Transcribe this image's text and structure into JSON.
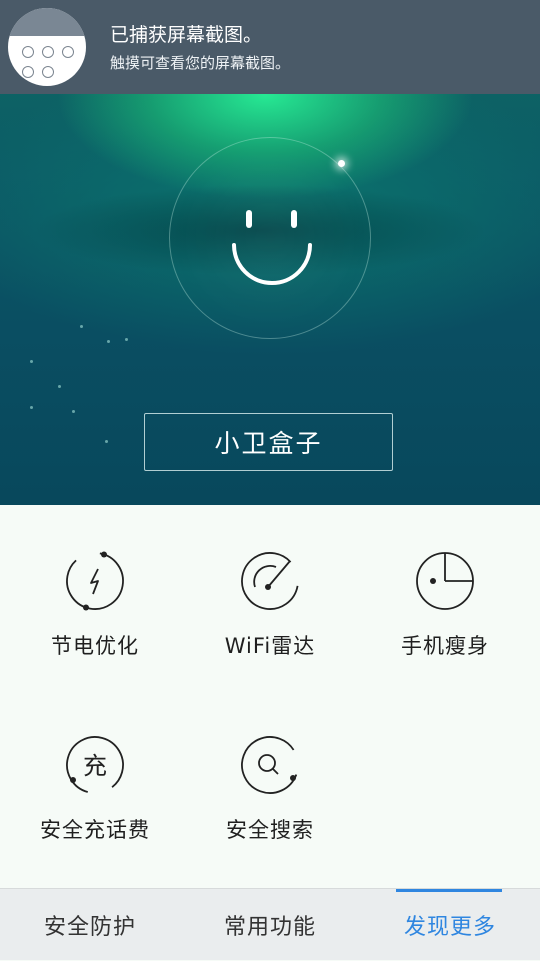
{
  "notification": {
    "title": "已捕获屏幕截图。",
    "subtitle": "触摸可查看您的屏幕截图。",
    "icon": "screenshot-thumbnail"
  },
  "hero": {
    "status_icon": "smiley-face-icon",
    "button_label": "小卫盒子"
  },
  "tools": [
    {
      "label": "节电优化",
      "icon": "lightning-icon"
    },
    {
      "label": "WiFi雷达",
      "icon": "radar-gauge-icon"
    },
    {
      "label": "手机瘦身",
      "icon": "pie-clock-icon"
    },
    {
      "label": "安全充话费",
      "icon": "recharge-icon",
      "icon_text": "充"
    },
    {
      "label": "安全搜索",
      "icon": "search-icon"
    }
  ],
  "bottom_nav": {
    "tabs": [
      {
        "label": "安全防护"
      },
      {
        "label": "常用功能"
      },
      {
        "label": "发现更多"
      }
    ],
    "active_tab": "发现更多",
    "active_color": "#2f86e0"
  }
}
